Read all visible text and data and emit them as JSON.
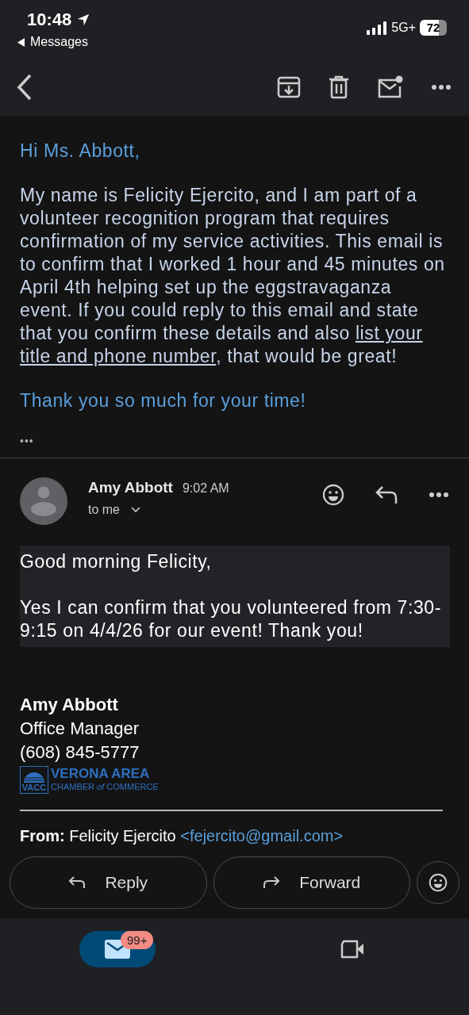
{
  "status_bar": {
    "time": "10:48",
    "back_app": "Messages",
    "network": "5G+",
    "battery": "72"
  },
  "first_message": {
    "greeting": "Hi Ms. Abbott,",
    "body": "My name is Felicity Ejercito, and I am part of a volunteer recognition program that requires confirmation of my service activities. This email is to confirm that I worked 1 hour and 45 minutes on April 4th helping set up the eggstravaganza event. If you could reply to this email and state that you confirm these details and also ",
    "link": [
      "list your",
      "title and phone number"
    ],
    "body_end": ", that would be great!",
    "closing": "Thank you so much for your time!",
    "more": "•••"
  },
  "reply_message": {
    "sender": "Amy Abbott",
    "time": "9:02 AM",
    "recipient": "to me",
    "lines": [
      "Good morning Felicity,",
      "Yes I can confirm that you volunteered from 7:30-9:15 on 4/4/26 for our event! Thank you!"
    ],
    "signature": {
      "name": "Amy Abbott",
      "title": "Office Manager",
      "phone": "(608) 845-5777",
      "logo": {
        "mark": "VACC",
        "line_1": "VERONA AREA",
        "line_2a": "CHAMBER",
        "line_2b": "of",
        "line_2c": "COMMERCE"
      }
    },
    "quoted": {
      "label": "From:",
      "name": "Felicity Ejercito",
      "email": "<fejercito@gmail.com>"
    }
  },
  "actions": [
    {
      "label": "Reply",
      "kind": "reply"
    },
    {
      "label": "Forward",
      "kind": "forward"
    }
  ],
  "bottom_nav": [
    {
      "kind": "mail",
      "selected": true,
      "badge": "99+"
    },
    {
      "kind": "video",
      "selected": false
    }
  ]
}
